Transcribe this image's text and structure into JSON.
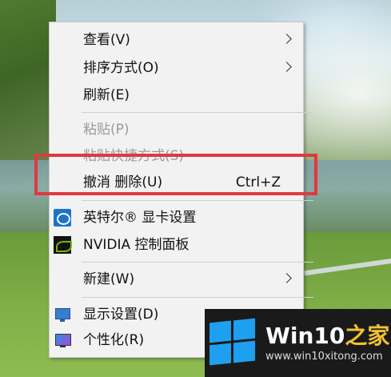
{
  "menu": {
    "items": [
      {
        "label": "查看(V)"
      },
      {
        "label": "排序方式(O)"
      },
      {
        "label": "刷新(E)"
      },
      {
        "label": "粘贴(P)"
      },
      {
        "label": "粘贴快捷方式(S)"
      },
      {
        "label": "撤消 删除(U)",
        "shortcut": "Ctrl+Z"
      },
      {
        "label": "英特尔® 显卡设置",
        "icon": "intel-graphics-icon"
      },
      {
        "label": "NVIDIA 控制面板",
        "icon": "nvidia-icon"
      },
      {
        "label": "新建(W)"
      },
      {
        "label": "显示设置(D)",
        "icon": "display-icon"
      },
      {
        "label": "个性化(R)",
        "icon": "personalize-icon"
      }
    ]
  },
  "watermark": {
    "title_main": "Win10",
    "title_accent": "之家",
    "url": "www.win10xitong.com"
  },
  "colors": {
    "highlight": "#e2383f",
    "menu_bg": "#f2f2f2",
    "disabled_text": "#9a9a9a",
    "brand_blue": "#1ea0f0"
  }
}
